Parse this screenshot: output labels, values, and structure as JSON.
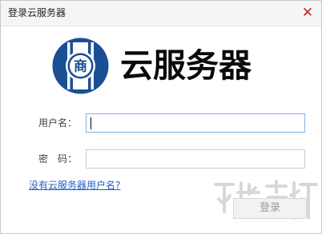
{
  "window": {
    "title": "登录云服务器",
    "close_glyph": "✕"
  },
  "brand": {
    "name": "云服务器",
    "logo_char": "商",
    "logo_color": "#1b4f93"
  },
  "form": {
    "username_label": "用户名：",
    "username_value": "",
    "password_label": "密　码：",
    "password_value": "",
    "no_account_link": "没有云服务器用户名?",
    "login_button": "登录"
  }
}
